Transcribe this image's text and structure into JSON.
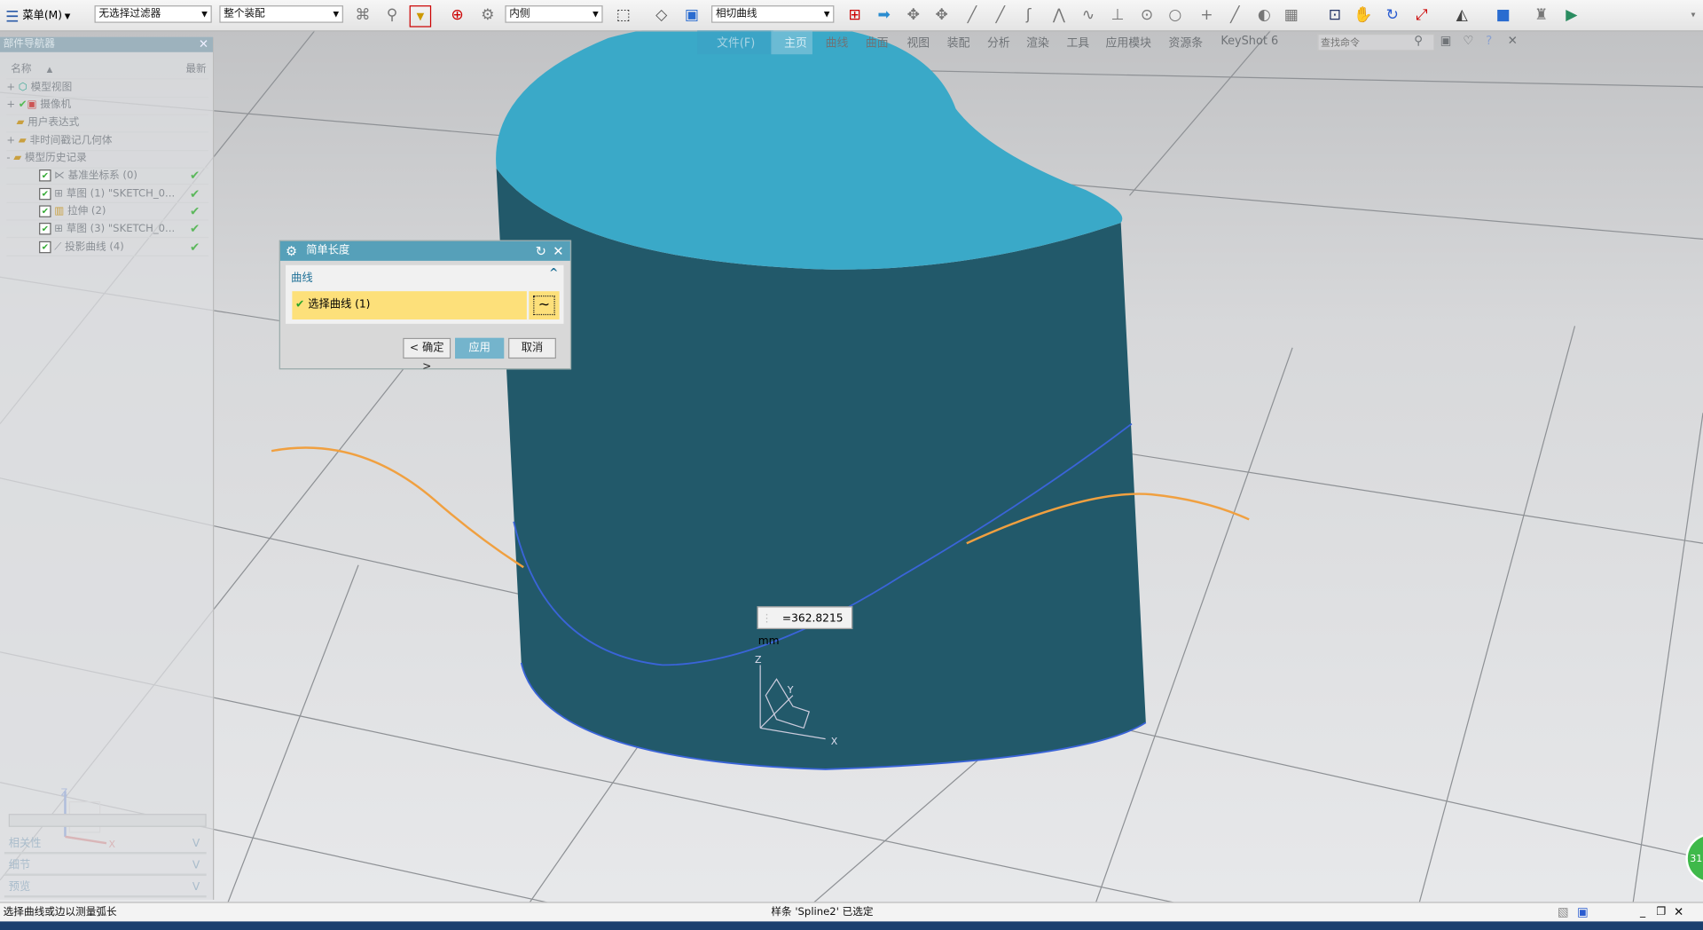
{
  "toolbar": {
    "menu_label": "菜单(M)",
    "selection_filter": "无选择过滤器",
    "scope": "整个装配",
    "curve_rule_side": "内侧",
    "curve_rule": "相切曲线"
  },
  "ribbon": {
    "tabs": [
      "文件(F)",
      "主页",
      "曲线",
      "曲面",
      "视图",
      "装配",
      "分析",
      "渲染",
      "工具",
      "应用模块",
      "资源条",
      "KeyShot 6"
    ],
    "active_tab": "主页",
    "search_placeholder": "查找命令"
  },
  "navigator": {
    "title": "部件导航器",
    "col_name": "名称",
    "col_latest": "最新",
    "items": [
      {
        "label": "模型视图",
        "expander": "+"
      },
      {
        "label": "摄像机",
        "expander": "+"
      },
      {
        "label": "用户表达式",
        "expander": ""
      },
      {
        "label": "非时间戳记几何体",
        "expander": "+"
      },
      {
        "label": "模型历史记录",
        "expander": "-"
      },
      {
        "label": "基准坐标系 (0)",
        "checked": true,
        "latest": true
      },
      {
        "label": "草图 (1) \"SKETCH_0...",
        "checked": true,
        "latest": true
      },
      {
        "label": "拉伸 (2)",
        "checked": true,
        "latest": true
      },
      {
        "label": "草图 (3) \"SKETCH_0...",
        "checked": true,
        "latest": true
      },
      {
        "label": "投影曲线 (4)",
        "checked": true,
        "latest": true
      }
    ],
    "sections": [
      "相关性",
      "细节",
      "预览"
    ]
  },
  "dialog": {
    "title": "简单长度",
    "group": "曲线",
    "select_label": "选择曲线 (1)",
    "ok": "< 确定 >",
    "apply": "应用",
    "cancel": "取消"
  },
  "measurement": "=362.8215 mm",
  "triad": {
    "x": "X",
    "y": "Y",
    "z": "Z"
  },
  "badge": "31",
  "status": {
    "prompt": "选择曲线或边以测量弧长",
    "message": "样条 'Spline2' 已选定"
  },
  "colors": {
    "body_top": "#3aa9c8",
    "body_side": "#22596a",
    "curve_orange": "#f0a040",
    "curve_blue": "#3a64d8",
    "dialog_header": "#56a0b9",
    "highlight": "#fde07a"
  }
}
